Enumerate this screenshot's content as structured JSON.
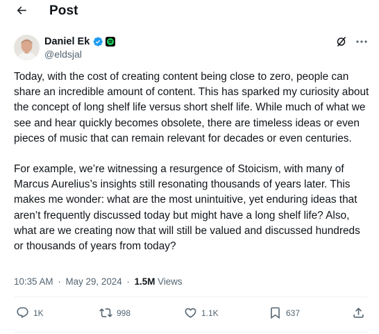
{
  "header": {
    "title": "Post"
  },
  "author": {
    "name": "Daniel Ek",
    "handle": "@eldsjal",
    "verified_color": "#1d9bf0",
    "affiliate_color": "#1ed760"
  },
  "tweet": {
    "paragraphs": [
      "Today, with the cost of creating content being close to zero, people can share an incredible amount of content. This has sparked my curiosity about the concept of long shelf life versus short shelf life. While much of what we see and hear quickly becomes obsolete, there are timeless ideas or even pieces of music that can remain relevant for decades or even centuries.",
      "For example, we’re witnessing a resurgence of Stoicism, with many of Marcus Aurelius’s insights still resonating thousands of years later. This makes me wonder: what are the most unintuitive, yet enduring ideas that aren’t frequently discussed today but might have a long shelf life? Also, what are we creating now that will still be valued and discussed hundreds or thousands of years from today?"
    ],
    "time": "10:35 AM",
    "date": "May 29, 2024",
    "separator": "·",
    "views_count": "1.5M",
    "views_label": "Views"
  },
  "actions": {
    "replies": "1K",
    "reposts": "998",
    "likes": "1.1K",
    "bookmarks": "637"
  },
  "icons": {
    "back": "arrow-left-icon",
    "verified": "verified-badge-icon",
    "affiliate": "spotify-icon",
    "grok": "grok-icon",
    "more": "more-icon",
    "reply": "reply-icon",
    "repost": "repost-icon",
    "like": "heart-icon",
    "bookmark": "bookmark-icon",
    "share": "share-icon"
  }
}
